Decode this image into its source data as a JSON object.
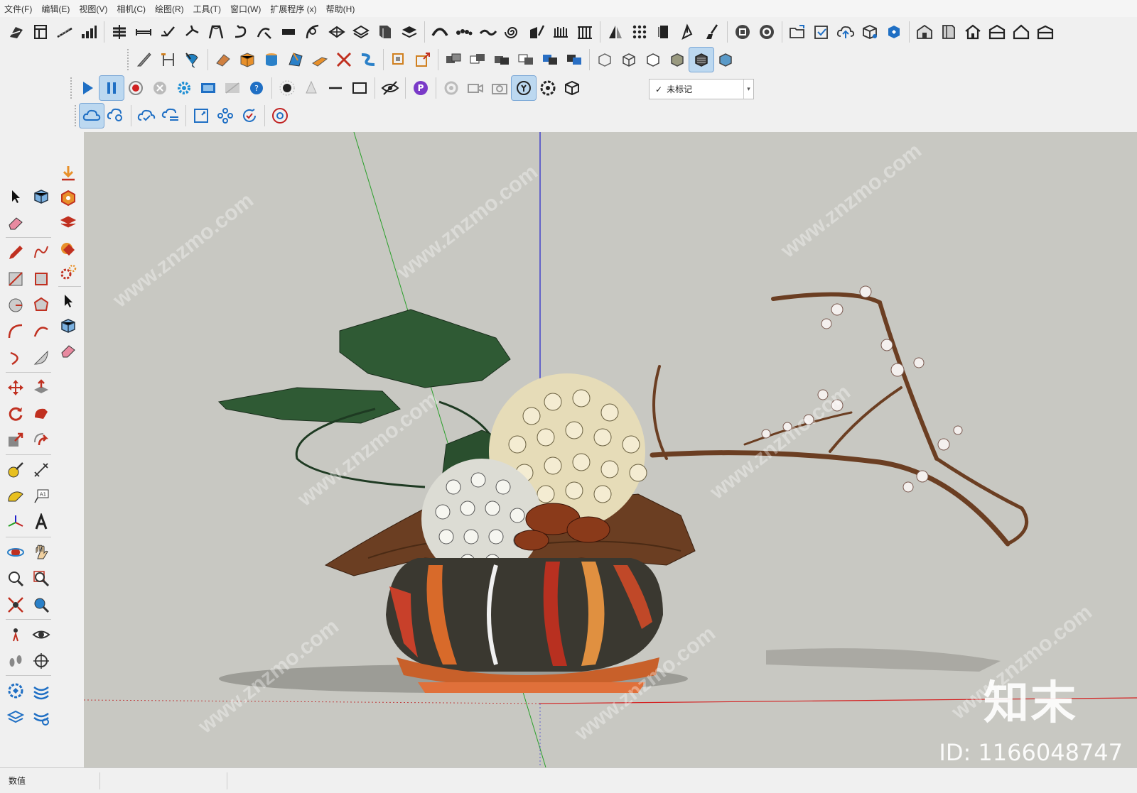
{
  "menu": [
    "文件(F)",
    "编辑(E)",
    "视图(V)",
    "相机(C)",
    "绘图(R)",
    "工具(T)",
    "窗口(W)",
    "扩展程序 (x)",
    "帮助(H)"
  ],
  "tag_dropdown": {
    "check": "✓",
    "value": "未标记"
  },
  "status": {
    "measurements_label": "数值"
  },
  "watermark": {
    "site": "www.znzmo.com",
    "brand": "知末",
    "id_text": "ID: 1166048747"
  },
  "colors": {
    "accent": "#1f6fc4",
    "viewport_bg": "#c8c8c2",
    "axis_red": "#d42020",
    "axis_green": "#2aa02a",
    "axis_blue": "#2020cc",
    "leaf": "#2f5a34",
    "branch": "#6b3e22",
    "vase": "#3a3830"
  },
  "icons": {
    "row1": [
      "sandbox-icon",
      "layout-icon",
      "stairs-icon",
      "bars-icon",
      "grid-stack-icon",
      "dimension-icon",
      "bend-icon",
      "rotate-icon",
      "frame-icon",
      "undo-curve-icon",
      "curve-tool-icon",
      "plank-icon",
      "path-icon",
      "scale-icon",
      "mirror-icon",
      "cabinet-icon",
      "layer-icon",
      "arch-icon",
      "beads-icon",
      "wave-icon",
      "spiral-icon",
      "edit-draw-icon",
      "comb-icon",
      "column-icon",
      "triangle-icon",
      "dots-grid-icon",
      "panel-icon",
      "pen-tip-icon",
      "brush-icon",
      "film-icon",
      "gear-circle-icon",
      "folder-icon",
      "checkbox-icon",
      "cloud-upload-icon",
      "cube-gear-icon",
      "sync-icon",
      "warehouse-icon",
      "book-icon",
      "house-icon",
      "house-roof-icon",
      "house-outline-icon",
      "garage-icon"
    ],
    "row2": [
      "knife-icon",
      "measure-icon",
      "follow-me-icon",
      "eraser-box-icon",
      "box-orange-icon",
      "cylinder-icon",
      "shape-icon",
      "wedge-icon",
      "cross-cut-icon",
      "snake-icon",
      "square-frame-icon",
      "export-square-icon",
      "stack-boxes-icon",
      "boxes-2-icon",
      "boxes-3-icon",
      "boxes-4-icon",
      "boxes-5-icon",
      "boxes-6-icon",
      "face-style-icon",
      "wireframe-icon",
      "hidden-line-icon",
      "shaded-icon",
      "textured-icon",
      "monochrome-icon"
    ],
    "row3": [
      "play-icon",
      "pause-icon",
      "record-icon",
      "stop-icon",
      "settings-blue-icon",
      "film-strip-icon",
      "film-disabled-icon",
      "help-icon",
      "sphere-icon",
      "cone-icon",
      "line-icon",
      "rectangle-icon",
      "eye-hide-icon",
      "purple-p-icon",
      "spinner-icon",
      "camera-video-icon",
      "camera-photo-icon",
      "target-camera-icon",
      "flower-gear-icon",
      "cube-arrow-icon"
    ],
    "row4": [
      "cloud-sync-icon",
      "cloud-search-icon",
      "cloud-check-icon",
      "cloud-list-icon",
      "square-corner-icon",
      "network-icon",
      "refresh-check-icon",
      "chrome-like-icon"
    ]
  }
}
